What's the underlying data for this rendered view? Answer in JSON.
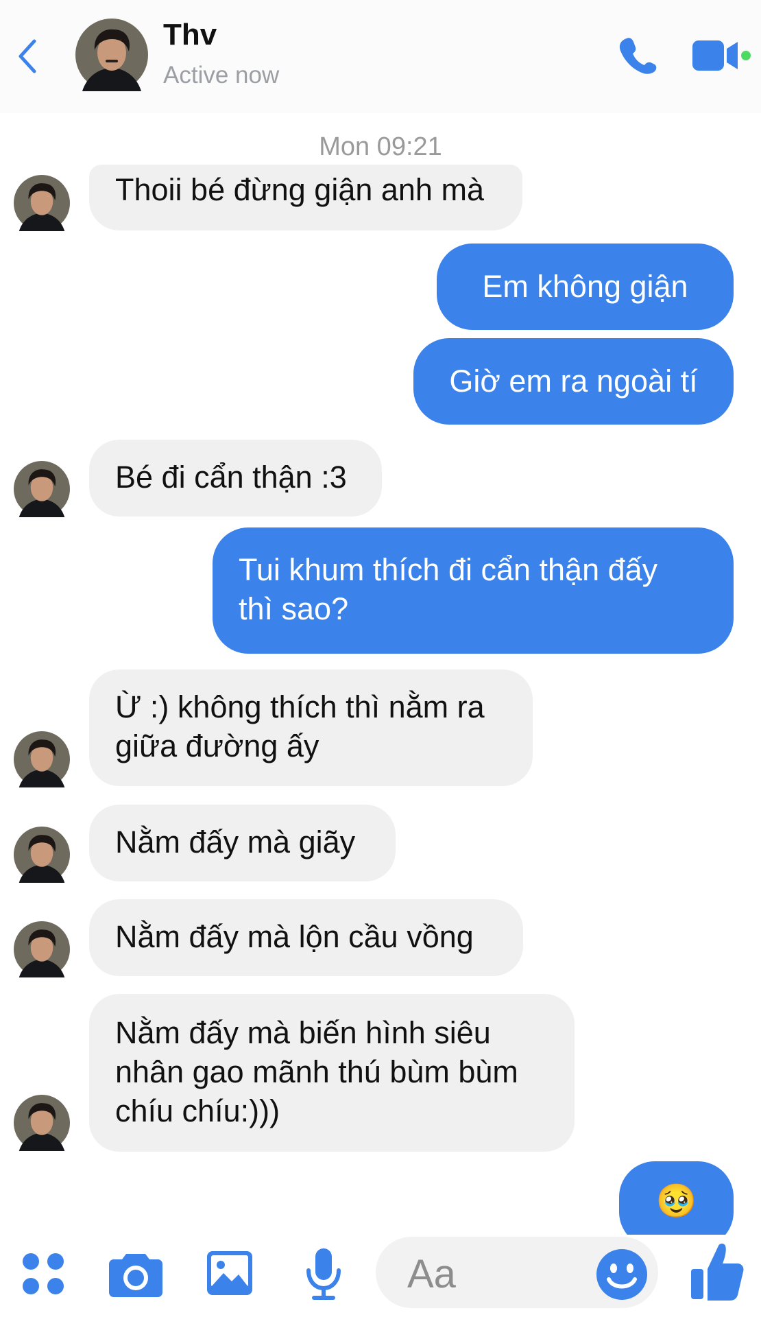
{
  "header": {
    "contact_name": "Thv",
    "status": "Active now"
  },
  "thread": {
    "timestamp": "Mon 09:21",
    "messages": [
      {
        "from": "them",
        "text": "Thoii bé đừng giận anh mà"
      },
      {
        "from": "me",
        "text": "Em không giận"
      },
      {
        "from": "me",
        "text": "Giờ em ra ngoài tí"
      },
      {
        "from": "them",
        "text": "Bé đi cẩn thận :3"
      },
      {
        "from": "me",
        "lines": [
          "Tui khum thích đi cẩn thận đấy",
          "thì sao?"
        ]
      },
      {
        "from": "them",
        "lines": [
          "Ừ :) không thích thì nằm ra",
          "giữa đường ấy"
        ]
      },
      {
        "from": "them",
        "text": "Nằm đấy mà giãy"
      },
      {
        "from": "them",
        "text": "Nằm đấy mà lộn cầu vồng"
      },
      {
        "from": "them",
        "lines": [
          "Nằm đấy mà biến hình siêu",
          "nhân gao mãnh thú bùm bùm",
          "chíu chíu:)))"
        ]
      },
      {
        "from": "me",
        "text": "🥹"
      }
    ]
  },
  "composer": {
    "placeholder": "Aa"
  },
  "colors": {
    "accent": "#3b82ea",
    "incoming_bubble": "#f0f0f0",
    "online_dot": "#4cd964"
  },
  "icons": [
    "back-chevron-icon",
    "phone-icon",
    "video-camera-icon",
    "apps-grid-icon",
    "camera-icon",
    "gallery-icon",
    "microphone-icon",
    "emoji-icon",
    "thumbs-up-icon"
  ]
}
